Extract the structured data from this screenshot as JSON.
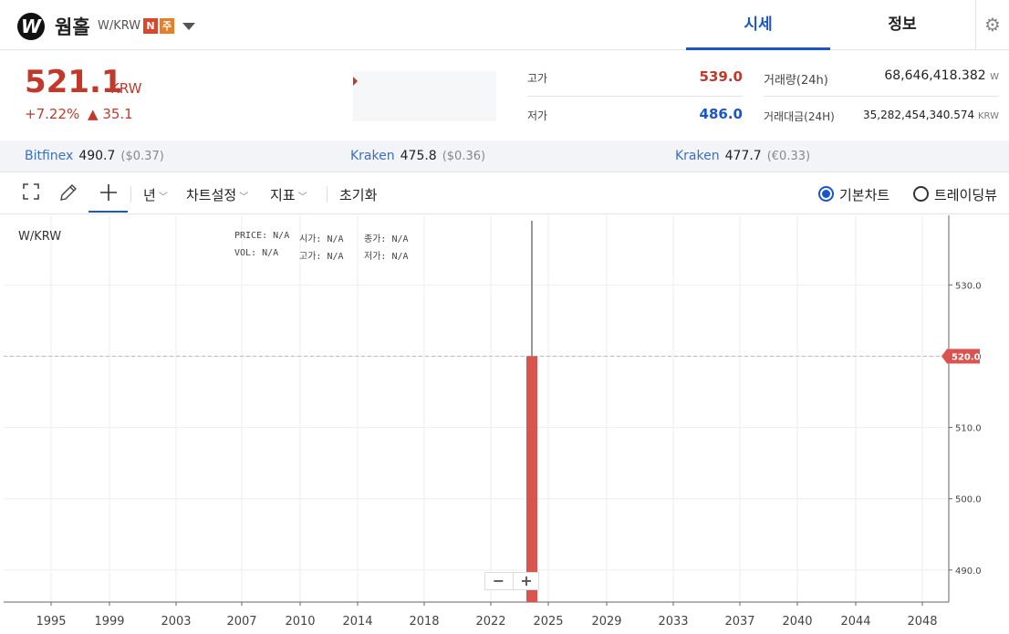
{
  "header": {
    "logo_letter": "W",
    "coin_name": "웜홀",
    "pair": "W/KRW",
    "badge_n": "N",
    "badge_j": "주",
    "tabs": [
      {
        "label": "시세"
      },
      {
        "label": "정보"
      }
    ],
    "settings_icon": "gear-icon"
  },
  "summary": {
    "price": "521.1",
    "unit": "KRW",
    "change_pct": "+7.22%",
    "change_abs": "▲ 35.1",
    "high_label": "고가",
    "high_value": "539.0",
    "low_label": "저가",
    "low_value": "486.0",
    "volume_label": "거래량(24h)",
    "volume_value": "68,646,418.382",
    "volume_unit": "W",
    "amount_label": "거래대금(24H)",
    "amount_value": "35,282,454,340.574",
    "amount_unit": "KRW",
    "colors": {
      "up": "#c0392b",
      "down": "#1a56c9"
    }
  },
  "exchanges": [
    {
      "name": "Bitfinex",
      "price": "490.7",
      "sub": "($0.37)"
    },
    {
      "name": "Kraken",
      "price": "475.8",
      "sub": "($0.36)"
    },
    {
      "name": "Kraken",
      "price": "477.7",
      "sub": "(€0.33)"
    }
  ],
  "toolbar": {
    "fullscreen_icon": "fullscreen-icon",
    "pencil_icon": "pencil-icon",
    "crosshair_icon": "crosshair-icon",
    "period": "년",
    "chart_settings": "차트설정",
    "indicators": "지표",
    "reset": "초기화",
    "radio_basic": "기본차트",
    "radio_tv": "트레이딩뷰",
    "selected_chart": "기본차트"
  },
  "chart": {
    "symbol": "W/KRW",
    "ohlc": {
      "price_label": "PRICE:",
      "price_value": "N/A",
      "open_label": "시가:",
      "open_value": "N/A",
      "close_label": "종가:",
      "close_value": "N/A",
      "vol_label": "VOL:",
      "vol_value": "N/A",
      "high_label": "고가:",
      "high_value": "N/A",
      "low_label": "저가:",
      "low_value": "N/A"
    },
    "zoom_out": "−",
    "zoom_in": "+"
  },
  "chart_data": {
    "type": "bar",
    "x_ticks": [
      "1995",
      "1999",
      "2003",
      "2007",
      "2010",
      "2014",
      "2018",
      "2022",
      "2025",
      "2029",
      "2033",
      "2037",
      "2040",
      "2044",
      "2048"
    ],
    "y_ticks": [
      490.0,
      500.0,
      510.0,
      520.0,
      530.0
    ],
    "y_tick_labels": [
      "490.0",
      "500.0",
      "510.0",
      "520.0",
      "530.0"
    ],
    "ylim": [
      485.5,
      539.0
    ],
    "last_price": 520.0,
    "last_price_label": "520.0",
    "candle": {
      "year": 2024,
      "open": 486.0,
      "high": 539.0,
      "low": 486.0,
      "close": 520.0
    },
    "grid": true,
    "colors": {
      "candle": "#d9534f",
      "wick": "#777777",
      "grid": "#eeeeee",
      "axis": "#666666",
      "last_price_bg": "#d9534f"
    }
  }
}
